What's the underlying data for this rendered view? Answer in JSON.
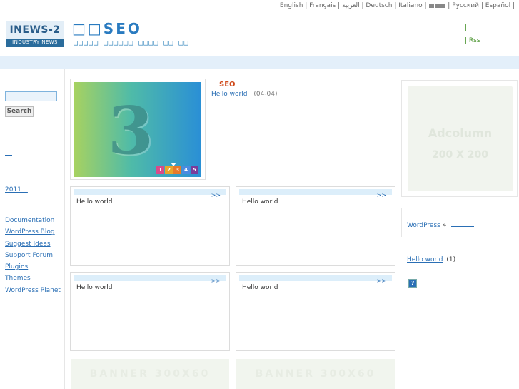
{
  "langbar": {
    "items": [
      "English",
      "Français",
      "العربية",
      "Deutsch",
      "Italiano",
      "Русский",
      "Español"
    ]
  },
  "header": {
    "logo_top": "INEWS-2",
    "logo_bottom": "INDUSTRY NEWS",
    "site_title": "□□SEO",
    "site_desc": "□□□□□ □□□□□□ □□□□ □□ □□",
    "rss_bar": "|",
    "rss_label": "| Rss"
  },
  "sidebar": {
    "search_button": "Search",
    "archive": "2011　",
    "links": [
      "Documentation",
      "WordPress Blog",
      "Suggest Ideas",
      "Support Forum",
      "Plugins",
      "Themes",
      "WordPress Planet"
    ]
  },
  "featured": {
    "slide_number": "3",
    "pager": [
      "1",
      "2",
      "3",
      "4",
      "5"
    ],
    "pager_colors": [
      "#d94a8b",
      "#e8a52a",
      "#e87a2a",
      "#4a8be0",
      "#7a3c9a"
    ],
    "category": "SEO",
    "post_title": "Hello world",
    "post_date": "(04-04)"
  },
  "boxes": [
    {
      "more": ">>",
      "title": "Hello world"
    },
    {
      "more": ">>",
      "title": "Hello world"
    },
    {
      "more": ">>",
      "title": "Hello world"
    },
    {
      "more": ">>",
      "title": "Hello world"
    }
  ],
  "banners": [
    "BANNER 300X60",
    "BANNER 300X60"
  ],
  "right": {
    "ad_line1": "Adcolumn",
    "ad_line2": "200 X 200",
    "wp_link": "WordPress",
    "wp_sep": "»",
    "recent_title": "Hello world",
    "recent_count": "(1)",
    "q_icon": "?"
  },
  "colors": {
    "accent": "#2a6fb5",
    "category": "#d04a1b",
    "rss": "#3a8b1c",
    "nav": "#e3effa"
  }
}
